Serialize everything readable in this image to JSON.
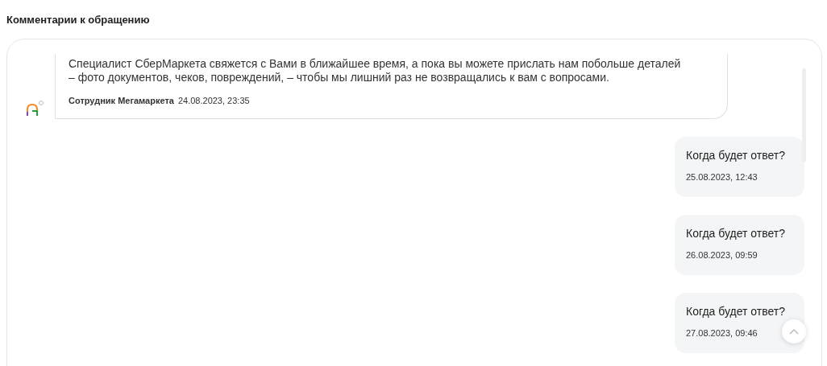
{
  "title": "Комментарии к обращению",
  "messages": [
    {
      "kind": "staff",
      "lines": [
        "Специалист СберМаркета свяжется с Вами в ближайшее время, а пока вы можете прислать нам побольше деталей",
        "– фото документов, чеков, повреждений, – чтобы мы лишний раз не возвращались к вам с вопросами."
      ],
      "author": "Сотрудник Мегамаркета",
      "time": "24.08.2023, 23:35"
    },
    {
      "kind": "user",
      "lines": [
        "Когда будет ответ?"
      ],
      "time": "25.08.2023, 12:43"
    },
    {
      "kind": "user",
      "lines": [
        "Когда будет ответ?"
      ],
      "time": "26.08.2023, 09:59"
    },
    {
      "kind": "user",
      "lines": [
        "Когда будет ответ?"
      ],
      "time": "27.08.2023, 09:46"
    }
  ]
}
